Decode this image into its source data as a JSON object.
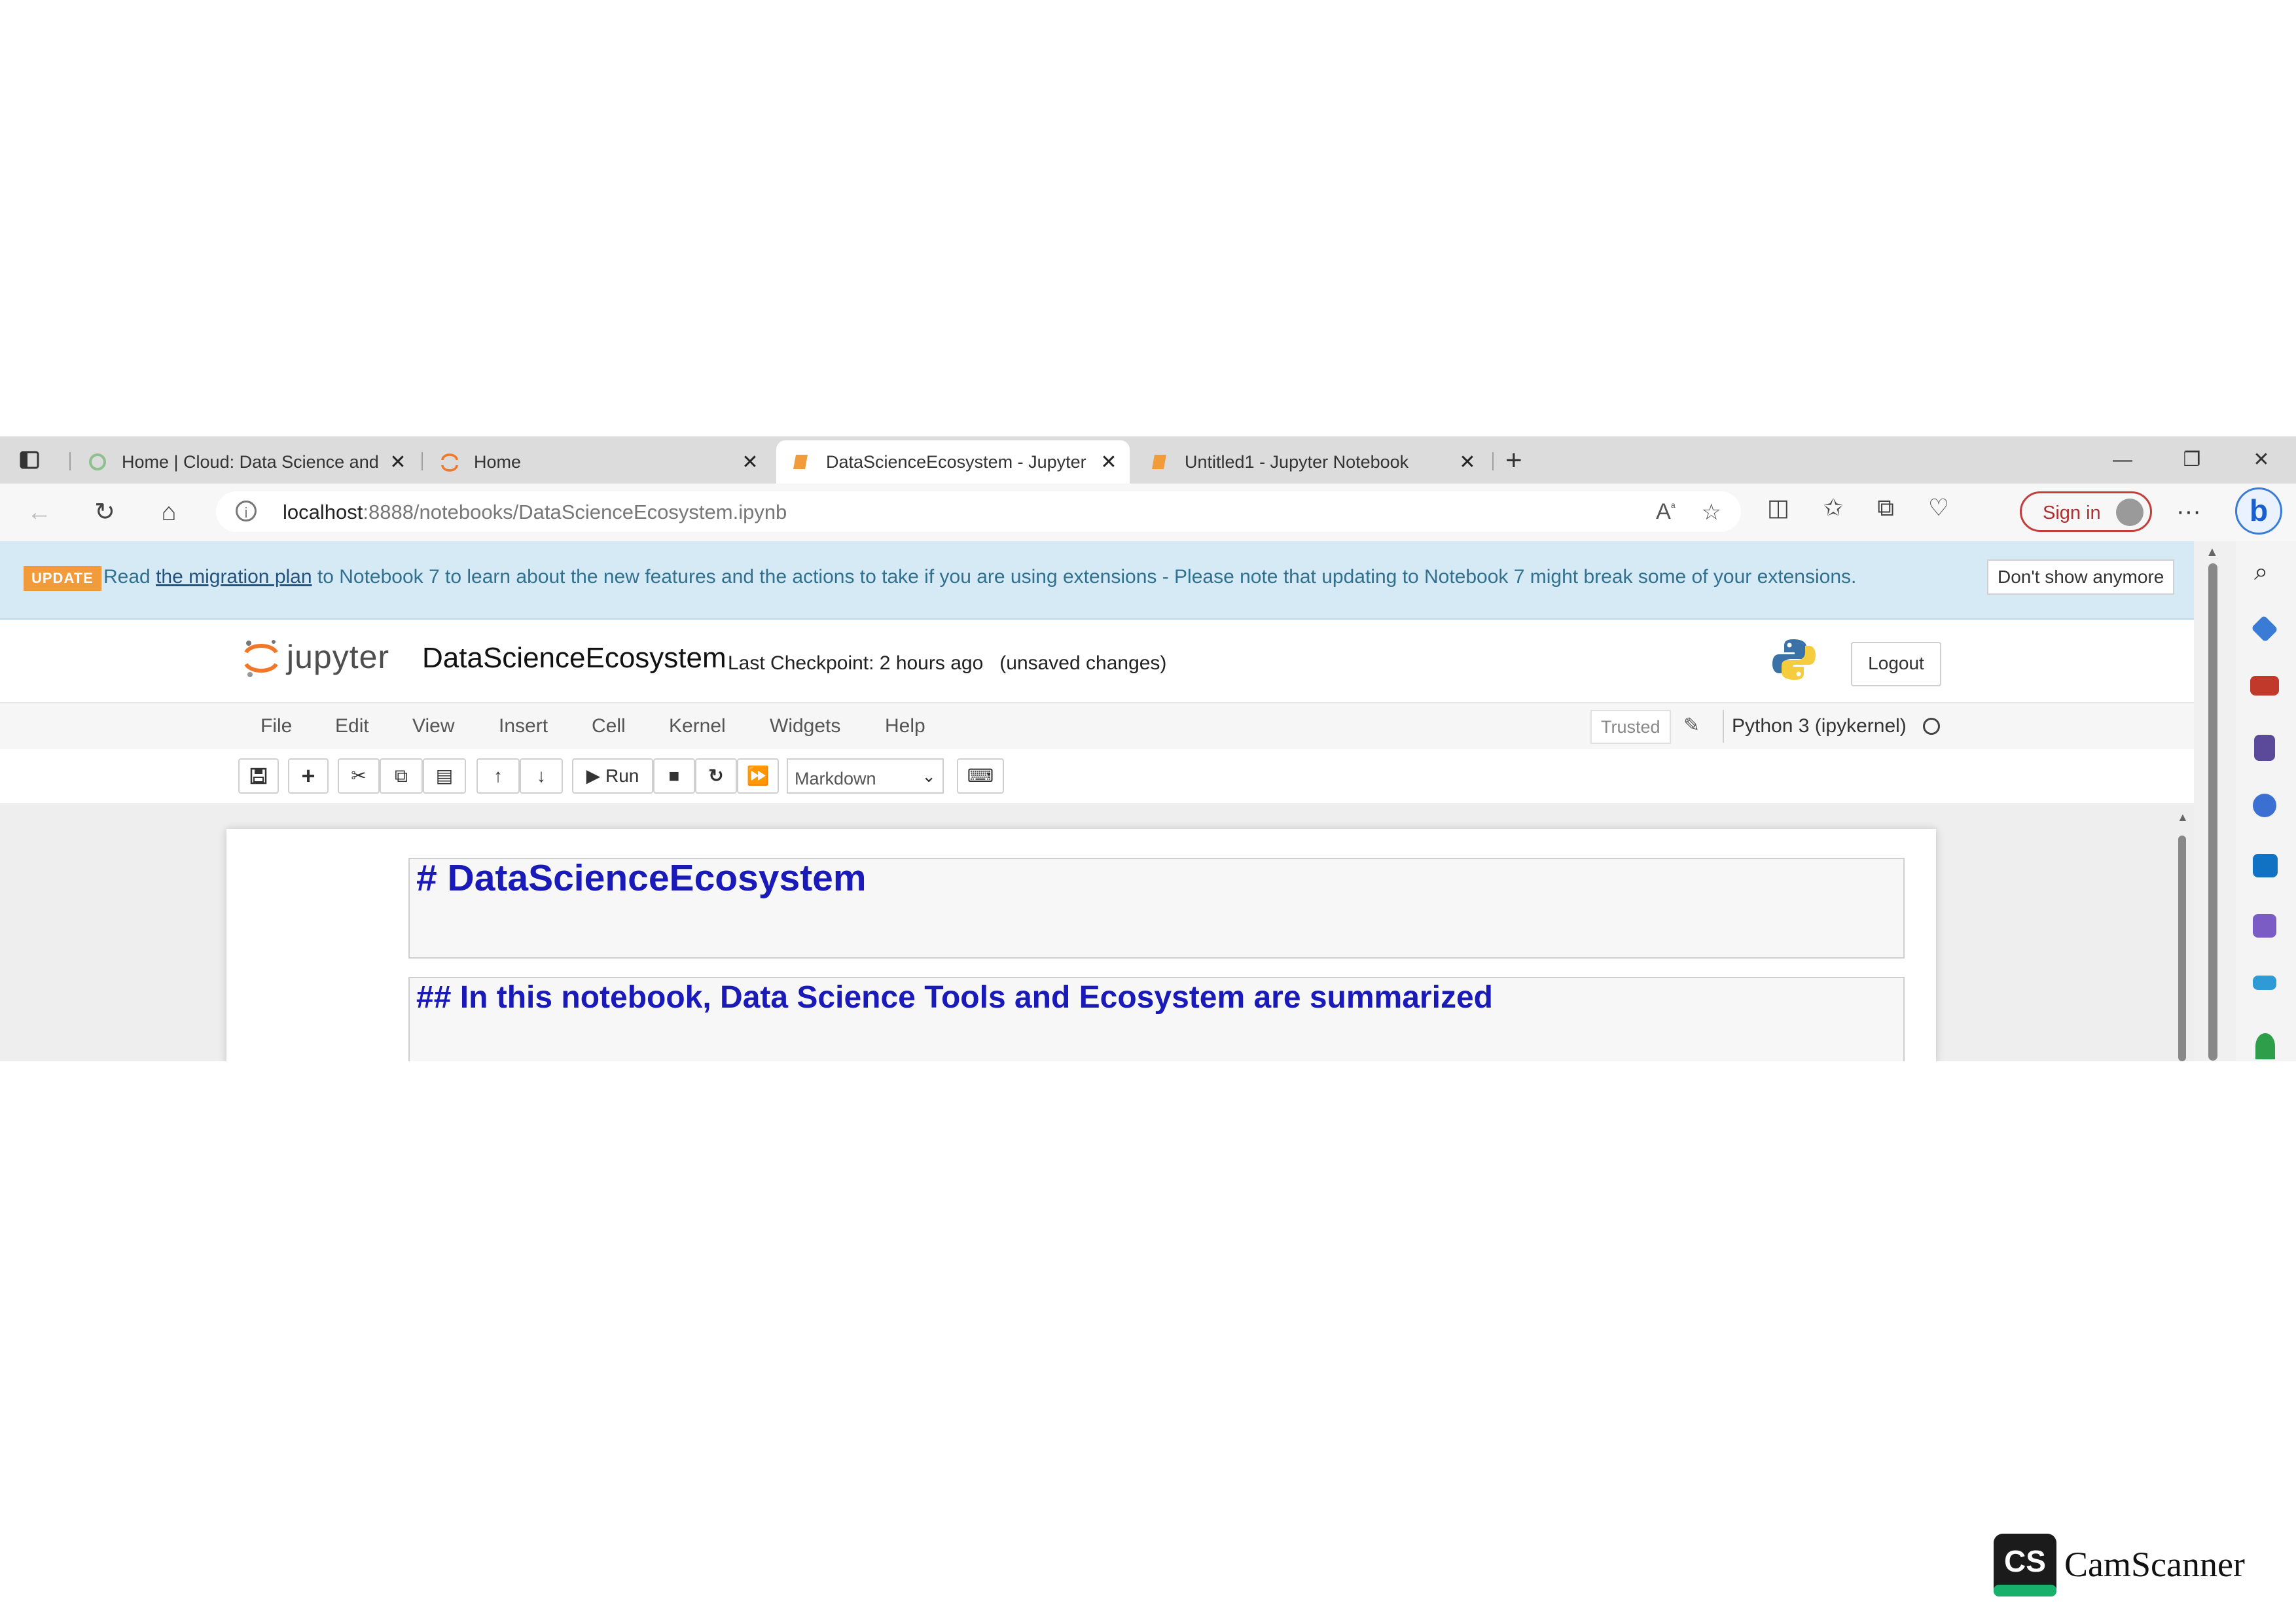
{
  "browser": {
    "tabs": [
      {
        "title": "Home | Cloud: Data Science and",
        "active": false
      },
      {
        "title": "Home",
        "active": false
      },
      {
        "title": "DataScienceEcosystem - Jupyter",
        "active": true
      },
      {
        "title": "Untitled1 - Jupyter Notebook",
        "active": false
      }
    ],
    "new_tab_label": "+",
    "url_host": "localhost",
    "url_path": ":8888/notebooks/DataScienceEcosystem.ipynb",
    "sign_in_label": "Sign in"
  },
  "update_banner": {
    "badge": "UPDATE",
    "text_before": "Read ",
    "link_text": "the migration plan",
    "text_after": " to Notebook 7 to learn about the new features and the actions to take if you are using extensions - Please note that updating to Notebook 7 might break some of your extensions.",
    "dismiss_label": "Don't show anymore"
  },
  "jupyter": {
    "logo_text": "jupyter",
    "notebook_name": "DataScienceEcosystem",
    "checkpoint": "Last Checkpoint: 2 hours ago",
    "unsaved": "(unsaved changes)",
    "logout_label": "Logout",
    "menu": [
      "File",
      "Edit",
      "View",
      "Insert",
      "Cell",
      "Kernel",
      "Widgets",
      "Help"
    ],
    "trusted_label": "Trusted",
    "kernel_name": "Python 3 (ipykernel)",
    "run_label": "Run",
    "cell_type": "Markdown"
  },
  "cells": [
    {
      "source": "#  DataScienceEcosystem"
    },
    {
      "source": "## In this notebook, Data Science Tools and Ecosystem are summarized"
    }
  ],
  "watermark": {
    "logo_text": "CS",
    "brand": "CamScanner"
  },
  "colors": {
    "jupyter_orange": "#f37726",
    "update_badge": "#f29b3a",
    "markdown_blue": "#1a1ab8",
    "banner_bg": "#d6eaf6"
  }
}
